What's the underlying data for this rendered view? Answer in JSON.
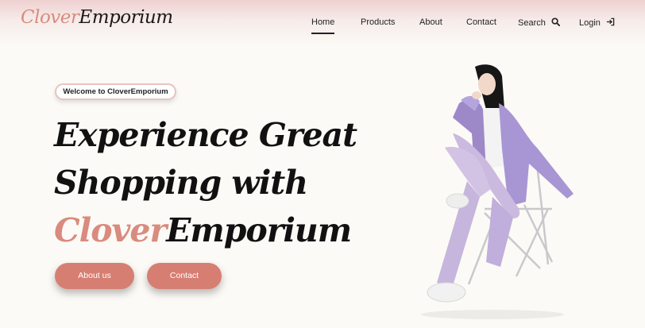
{
  "logo": {
    "accent": "Clover",
    "rest": "Emporium"
  },
  "nav": {
    "home": "Home",
    "products": "Products",
    "about": "About",
    "contact": "Contact",
    "search": "Search",
    "search_icon": "search-icon",
    "login": "Login",
    "login_icon": "login-icon"
  },
  "hero": {
    "welcome": "Welcome to CloverEmporium",
    "title_line1": "Experience Great",
    "title_line2": "Shopping with",
    "title_accent": "Clover",
    "title_rest": "Emporium",
    "about_button": "About us",
    "contact_button": "Contact",
    "figure": "model-photo"
  },
  "colors": {
    "accent": "#d98b7e",
    "button": "#d77e72",
    "background": "#fcfaf6",
    "header_top": "#efd0d0"
  }
}
